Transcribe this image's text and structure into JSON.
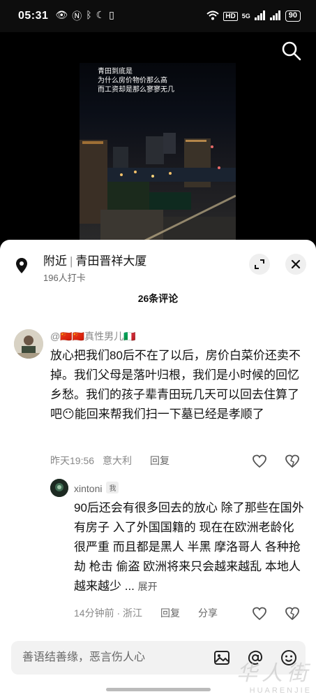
{
  "status_bar": {
    "time": "05:31",
    "battery": "90",
    "network": "5G",
    "hd": "HD"
  },
  "video": {
    "caption_lines": [
      "青田到底是",
      "为什么房价物价那么高",
      "而工资却是那么寥寥无几"
    ]
  },
  "location": {
    "prefix": "附近",
    "name": "青田晋祥大厦",
    "checkins": "196人打卡"
  },
  "comments_header": "26条评论",
  "comment1": {
    "username": "@🇨🇳🇨🇳真性男儿🇮🇹",
    "text": "放心把我们80后不在了以后，房价白菜价还卖不掉。我们父母是落叶归根，我们是小时候的回忆乡愁。我们的孩子辈青田玩几天可以回去住算了吧😶能回来帮我们扫一下墓已经是孝顺了",
    "time": "昨天19:56",
    "region": "意大利",
    "reply": "回复"
  },
  "comment2": {
    "username": "xintoni",
    "author_tag": "我",
    "text": "90后还会有很多回去的放心 除了那些在国外有房子 入了外国国籍的 现在在欧洲老龄化很严重 而且都是黑人 半黑 摩洛哥人 各种抢劫 枪击 偷盗 欧洲将来只会越来越乱 本地人越来越少 ...",
    "expand": "展开",
    "time": "14分钟前 · 浙江",
    "reply": "回复",
    "share": "分享"
  },
  "input": {
    "placeholder": "善语结善缘，恶言伤人心"
  },
  "watermark": {
    "brand": "华人街",
    "url": "HUARENJIE"
  },
  "colors": {
    "sheet_bg": "#ffffff",
    "text_primary": "#111111",
    "text_secondary": "#888888",
    "input_bg": "#f2f2f2"
  }
}
